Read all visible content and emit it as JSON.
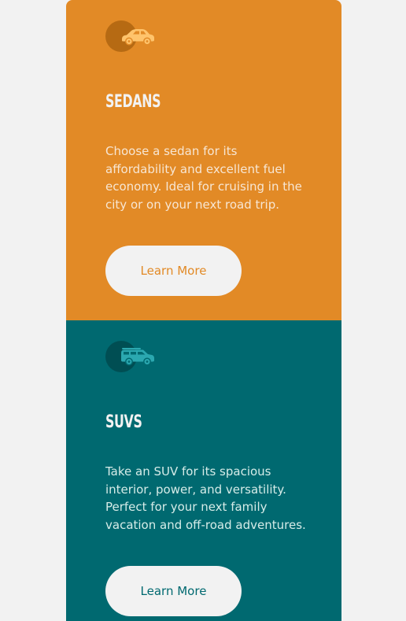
{
  "cards": [
    {
      "icon": "sedan-car-icon",
      "title": "SEDANS",
      "description": "Choose a sedan for its affordability and excellent fuel economy. Ideal for cruising in the city or on your next road trip.",
      "button_label": "Learn More",
      "background": "#e28a26",
      "accent": "#ffc46c"
    },
    {
      "icon": "suv-car-icon",
      "title": "SUVS",
      "description": "Take an SUV for its spacious interior, power, and versatility. Perfect for your next family vacation and off-road adventures.",
      "button_label": "Learn More",
      "background": "#006970",
      "accent": "#2ba8b0"
    }
  ],
  "colors": {
    "page_background": "#f2f2f2",
    "button_background": "#f2f2f2"
  }
}
